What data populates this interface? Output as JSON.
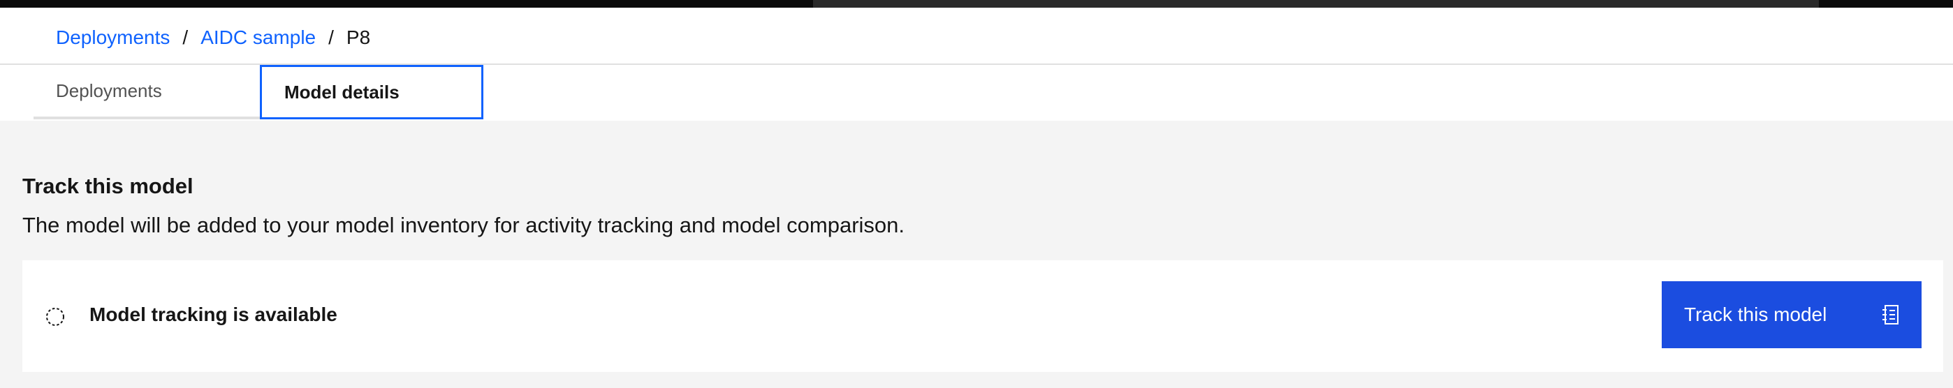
{
  "breadcrumb": {
    "items": [
      "Deployments",
      "AIDC sample",
      "P8"
    ],
    "separator": "/"
  },
  "tabs": [
    {
      "label": "Deployments",
      "active": false
    },
    {
      "label": "Model details",
      "active": true
    }
  ],
  "track": {
    "title": "Track this model",
    "description": "The model will be added to your model inventory for activity tracking and model comparison.",
    "status_text": "Model tracking is available",
    "status_icon": "dashed-circle-icon",
    "button_label": "Track this model",
    "button_icon": "notebook-icon"
  },
  "colors": {
    "accent": "#0f62fe",
    "button_bg": "#1b4de0",
    "content_bg": "#f4f4f4",
    "text": "#161616"
  }
}
